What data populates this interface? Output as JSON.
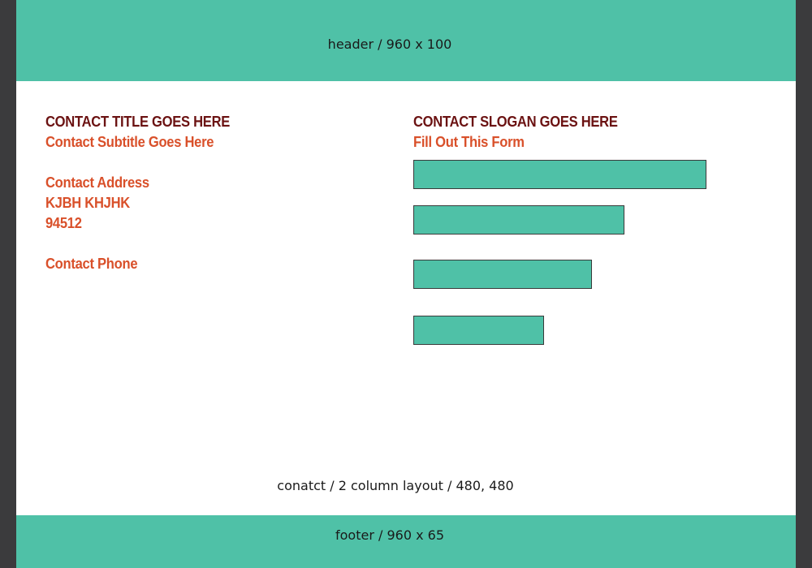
{
  "header": {
    "caption": "header / 960 x 100"
  },
  "contact_info": {
    "title": "CONTACT TITLE GOES HERE",
    "subtitle": "Contact Subtitle Goes Here",
    "address_label": "Contact Address",
    "address_line1": "KJBH KHJHK",
    "address_line2": "94512",
    "phone_label": "Contact Phone"
  },
  "contact_form": {
    "slogan": "CONTACT SLOGAN GOES HERE",
    "prompt": "Fill Out This Form",
    "fields": [
      {
        "value": ""
      },
      {
        "value": ""
      },
      {
        "value": ""
      },
      {
        "value": ""
      }
    ]
  },
  "content": {
    "caption": "conatct / 2 column layout / 480, 480"
  },
  "footer": {
    "caption": "footer / 960 x 65"
  },
  "colors": {
    "accent_teal": "#4fc1a7",
    "title_dark_red": "#6b1212",
    "text_orange": "#d9502a",
    "frame_gray": "#3b3b3d"
  }
}
